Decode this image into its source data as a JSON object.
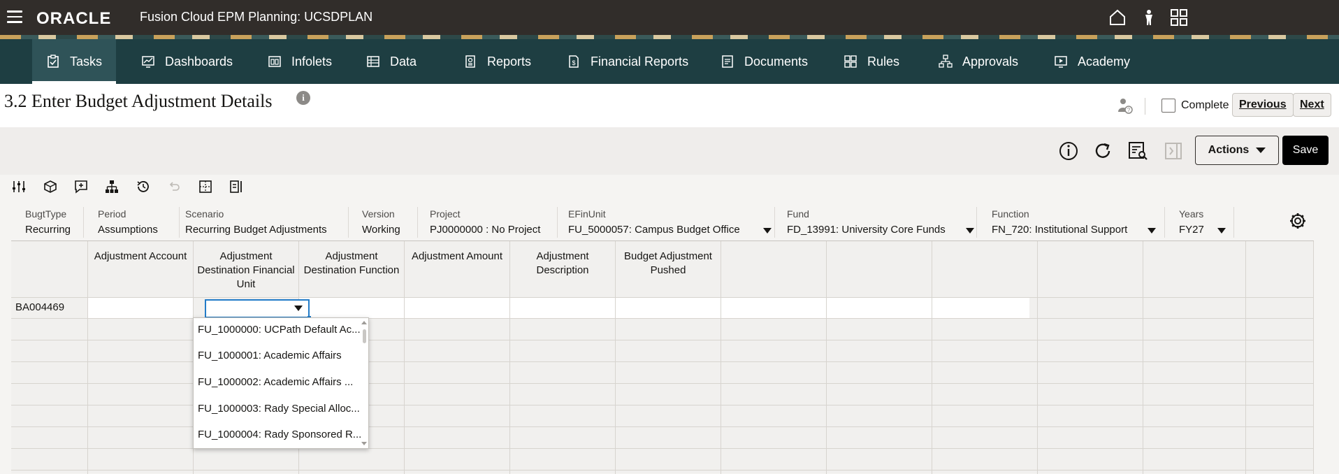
{
  "app": {
    "brand": "ORACLE",
    "title": "Fusion Cloud EPM Planning:  UCSDPLAN"
  },
  "nav": [
    {
      "label": "Tasks",
      "icon": "tasks-icon",
      "active": true
    },
    {
      "label": "Dashboards",
      "icon": "dashboards-icon"
    },
    {
      "label": "Infolets",
      "icon": "infolets-icon"
    },
    {
      "label": "Data",
      "icon": "data-icon"
    },
    {
      "label": "Reports",
      "icon": "reports-icon"
    },
    {
      "label": "Financial Reports",
      "icon": "financial-reports-icon"
    },
    {
      "label": "Documents",
      "icon": "documents-icon"
    },
    {
      "label": "Rules",
      "icon": "rules-icon"
    },
    {
      "label": "Approvals",
      "icon": "approvals-icon"
    },
    {
      "label": "Academy",
      "icon": "academy-icon"
    }
  ],
  "page": {
    "title": "3.2 Enter Budget Adjustment Details",
    "info_glyph": "i",
    "complete_label": "Complete",
    "previous_label": "Previous",
    "next_label": "Next"
  },
  "toolbar": {
    "actions_label": "Actions",
    "save_label": "Save"
  },
  "pov": [
    {
      "label": "BugtType",
      "value": "Recurring"
    },
    {
      "label": "Period",
      "value": "Assumptions"
    },
    {
      "label": "Scenario",
      "value": "Recurring Budget Adjustments"
    },
    {
      "label": "Version",
      "value": "Working"
    },
    {
      "label": "Project",
      "value": "PJ0000000 : No Project"
    },
    {
      "label": "EFinUnit",
      "value": "FU_5000057: Campus Budget Office"
    },
    {
      "label": "Fund",
      "value": "FD_13991: University Core Funds"
    },
    {
      "label": "Function",
      "value": "FN_720: Institutional Support"
    },
    {
      "label": "Years",
      "value": "FY27"
    }
  ],
  "grid": {
    "columns": [
      "Adjustment Account",
      "Adjustment Destination Financial Unit",
      "Adjustment Destination Function",
      "Adjustment Amount",
      "Adjustment Description",
      "Budget Adjustment Pushed"
    ],
    "row_header": "BA004469"
  },
  "dropdown": {
    "options": [
      "FU_1000000: UCPath Default Ac...",
      "FU_1000001: Academic Affairs",
      "FU_1000002: Academic Affairs ...",
      "FU_1000003: Rady Special Alloc...",
      "FU_1000004: Rady Sponsored R..."
    ]
  },
  "colors": {
    "topbar": "#312d2a",
    "navbar": "#1e3e42",
    "active_cell_border": "#227cc8"
  }
}
